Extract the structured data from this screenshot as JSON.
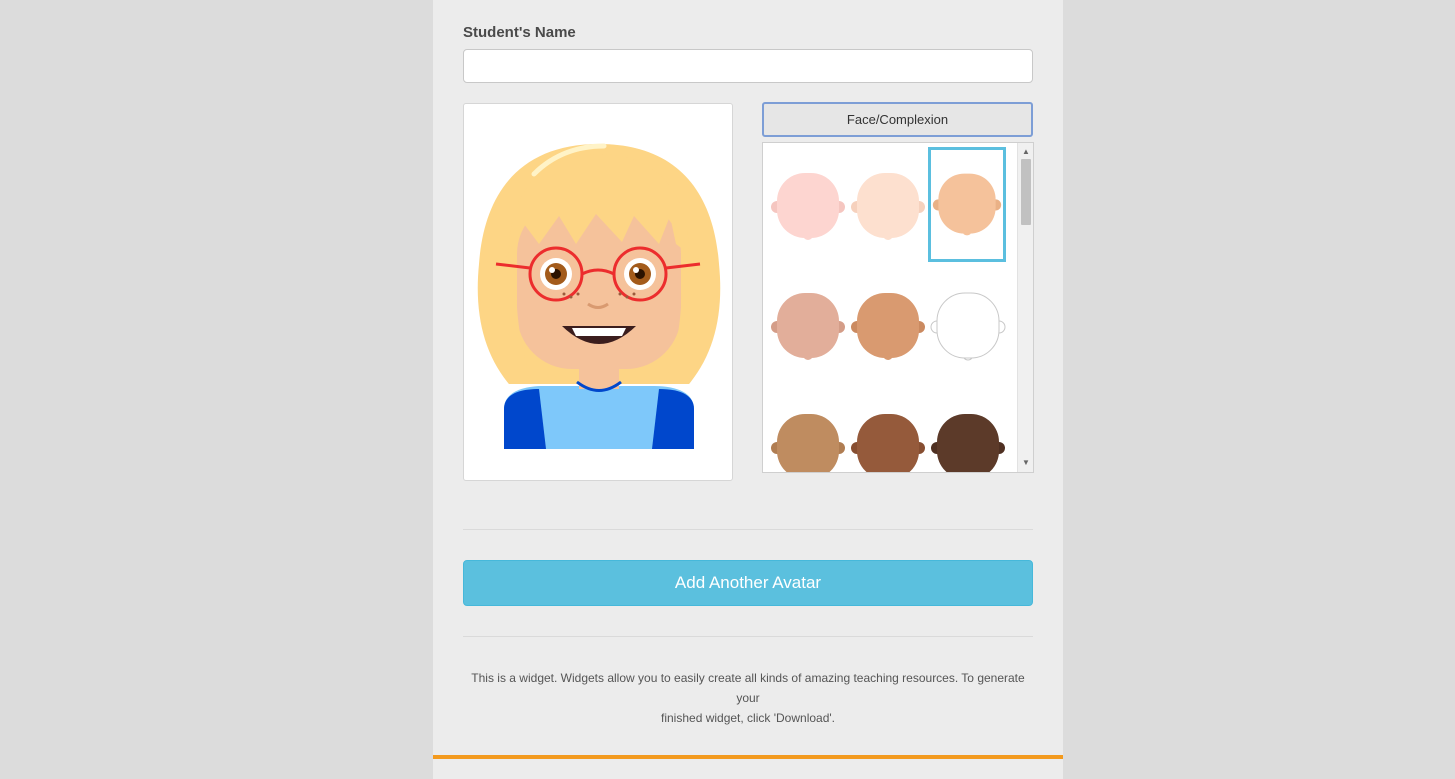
{
  "form": {
    "name_label": "Student's Name",
    "name_value": "",
    "name_placeholder": ""
  },
  "category": {
    "label": "Face/Complexion"
  },
  "complexions": [
    {
      "color": "#fdd5d0",
      "ear": "#f5c6c0",
      "selected": false
    },
    {
      "color": "#fde0cf",
      "ear": "#f6d1bd",
      "selected": false
    },
    {
      "color": "#f5c29b",
      "ear": "#eab186",
      "selected": true
    },
    {
      "color": "#e2ae9a",
      "ear": "#d49d88",
      "selected": false
    },
    {
      "color": "#d99a70",
      "ear": "#cb8a60",
      "selected": false
    },
    {
      "color": "#ffffff",
      "ear": "#ffffff",
      "selected": false
    },
    {
      "color": "#bf8c60",
      "ear": "#b07d52",
      "selected": false
    },
    {
      "color": "#955a3b",
      "ear": "#874e31",
      "selected": false
    },
    {
      "color": "#5c3a29",
      "ear": "#4f3022",
      "selected": false
    }
  ],
  "actions": {
    "add_avatar_label": "Add Another Avatar"
  },
  "footer": {
    "info_line1": "This is a widget. Widgets allow you to easily create all kinds of amazing teaching resources. To generate your",
    "info_line2": "finished widget, click 'Download'."
  },
  "colors": {
    "accent_blue": "#5bc0de",
    "selected_outline": "#5bbfdf",
    "bottom_bar": "#f39a1e"
  }
}
